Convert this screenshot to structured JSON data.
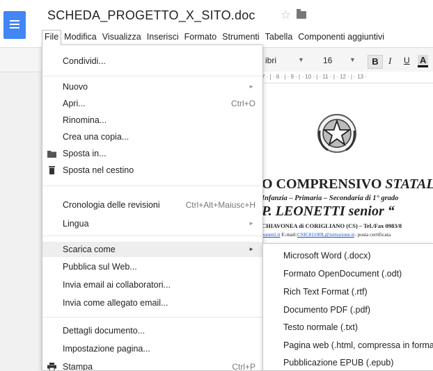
{
  "document": {
    "title": "SCHEDA_PROGETTO_X_SITO.doc"
  },
  "menubar": [
    "File",
    "Modifica",
    "Visualizza",
    "Inserisci",
    "Formato",
    "Strumenti",
    "Tabella",
    "Componenti aggiuntivi"
  ],
  "toolbar": {
    "font": "ibri",
    "size": "16",
    "bold": "B",
    "italic": "I",
    "underline": "U",
    "text_color": "A"
  },
  "ruler": "7 · | · 8 · | · 9 · | · 10 · | · 11 · | · 12 · | · 13 ·",
  "page_content": {
    "line1": "O COMPRENSIVO",
    "line1_italic": "STATAL",
    "line2": "Infanzia – Primaria – Secondaria di 1° grado",
    "line3": "P. LEONETTI senior “",
    "line4": "CHIAVONEA di CORIGLIANO (CS) – Tel./Fax  0983/8",
    "line5_link1": "eonetti.it",
    "line5_mid": " E-mail:",
    "line5_link2": "CSIC81100L@istruzione.it",
    "line5_end": "- posta certificata"
  },
  "file_menu": {
    "share": "Condividi...",
    "new": "Nuovo",
    "open": "Apri...",
    "open_shortcut": "Ctrl+O",
    "rename": "Rinomina...",
    "copy": "Crea una copia...",
    "move": "Sposta in...",
    "trash": "Sposta nel cestino",
    "history": "Cronologia delle revisioni",
    "history_shortcut": "Ctrl+Alt+Maiusc+H",
    "language": "Lingua",
    "download": "Scarica come",
    "publish": "Pubblica sul Web...",
    "email_collab": "Invia email ai collaboratori...",
    "email_attach": "Invia come allegato email...",
    "details": "Dettagli documento...",
    "page_setup": "Impostazione pagina...",
    "print": "Stampa",
    "print_shortcut": "Ctrl+P"
  },
  "download_submenu": [
    "Microsoft Word (.docx)",
    "Formato OpenDocument (.odt)",
    "Rich Text Format (.rtf)",
    "Documento PDF (.pdf)",
    "Testo normale (.txt)",
    "Pagina web (.html, compressa in forma",
    "Pubblicazione EPUB (.epub)"
  ],
  "colors": {
    "docs_blue": "#4285f4",
    "menu_highlight": "#eeeeee",
    "link": "#1155cc"
  },
  "icons": [
    "docs-logo-icon",
    "star-icon",
    "folder-icon",
    "submenu-arrow-icon",
    "trash-icon",
    "print-icon"
  ]
}
